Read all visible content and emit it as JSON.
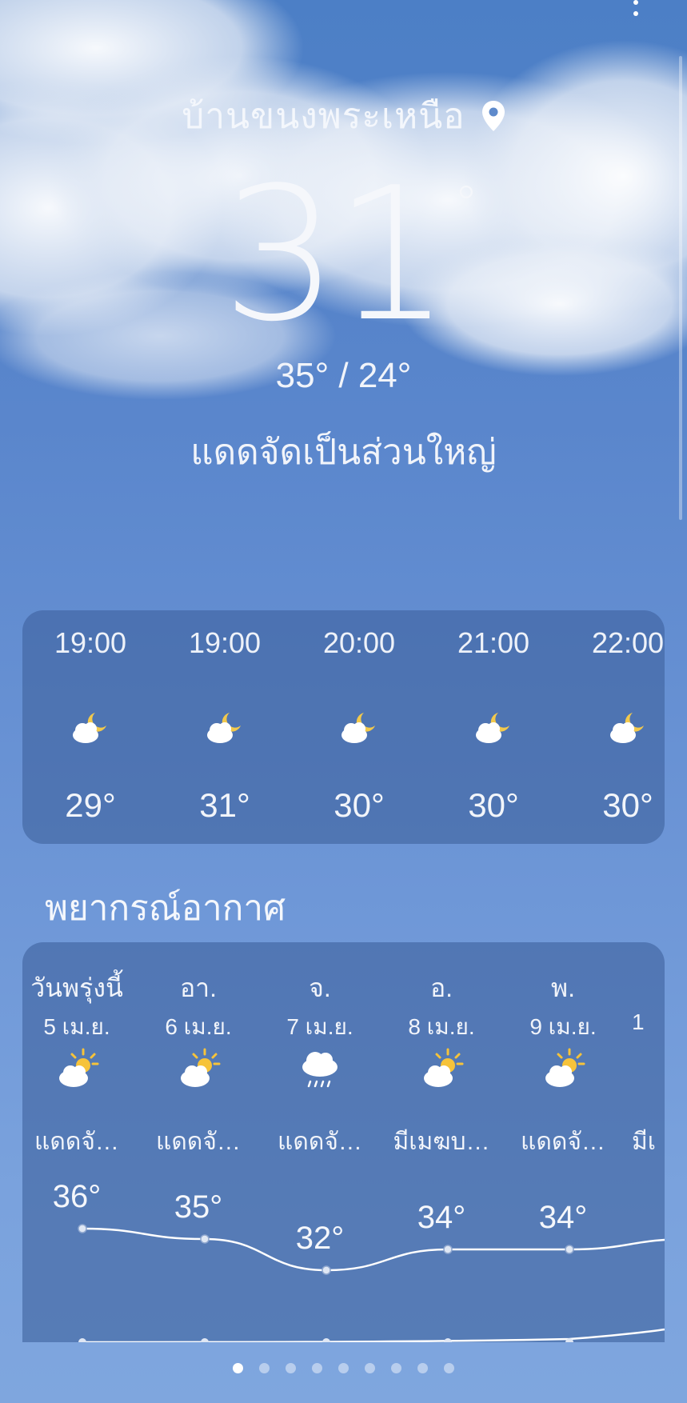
{
  "location": "บ้านขนงพระเหนือ",
  "current": {
    "temperature": "31",
    "degree_symbol": "°",
    "hi_lo": "35° / 24°",
    "condition": "แดดจัดเป็นส่วนใหญ่"
  },
  "hourly": [
    {
      "time": "19:00",
      "icon": "partly-cloudy-night-icon",
      "temp": "29°"
    },
    {
      "time": "19:00",
      "icon": "partly-cloudy-night-icon",
      "temp": "31°"
    },
    {
      "time": "20:00",
      "icon": "partly-cloudy-night-icon",
      "temp": "30°"
    },
    {
      "time": "21:00",
      "icon": "partly-cloudy-night-icon",
      "temp": "30°"
    },
    {
      "time": "22:00",
      "icon": "partly-cloudy-night-icon",
      "temp": "30°"
    }
  ],
  "forecast_title": "พยากรณ์อากาศ",
  "daily": [
    {
      "day": "วันพรุ่งนี้",
      "date": "5 เม.ย.",
      "icon": "partly-sunny-icon",
      "desc": "แดดจั…",
      "high": "36°",
      "high_value": 36
    },
    {
      "day": "อา.",
      "date": "6 เม.ย.",
      "icon": "partly-sunny-icon",
      "desc": "แดดจั…",
      "high": "35°",
      "high_value": 35
    },
    {
      "day": "จ.",
      "date": "7 เม.ย.",
      "icon": "rain-cloud-icon",
      "desc": "แดดจั…",
      "high": "32°",
      "high_value": 32
    },
    {
      "day": "อ.",
      "date": "8 เม.ย.",
      "icon": "partly-sunny-icon",
      "desc": "มีเมฆบ…",
      "high": "34°",
      "high_value": 34
    },
    {
      "day": "พ.",
      "date": "9 เม.ย.",
      "icon": "partly-sunny-icon",
      "desc": "แดดจั…",
      "high": "34°",
      "high_value": 34
    },
    {
      "day": "",
      "date": "1",
      "icon": "",
      "desc": "มีเ",
      "high": "",
      "high_value": 35
    }
  ],
  "page_indicator": {
    "count": 9,
    "active": 1
  },
  "colors": {
    "sun": "#f6c33a",
    "moon": "#f2c94c",
    "cloud": "#ffffff"
  }
}
